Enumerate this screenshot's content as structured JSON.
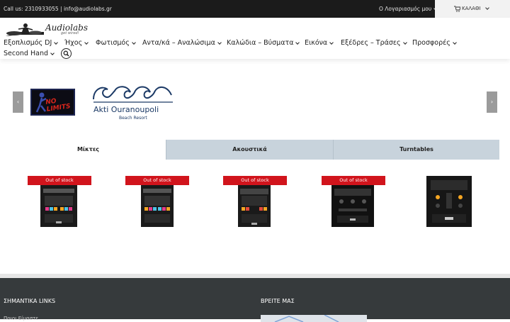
{
  "topbar": {
    "contact": "Call us: 2310933055  |  info@audiolabs.gr",
    "account": "Ο Λογαριασμός μου",
    "cart": "ΚΑΛΑΘΙ"
  },
  "logo": {
    "word": "Audiolabs",
    "tag": "get wired!"
  },
  "nav": {
    "items": [
      "Εξοπλισμός DJ",
      "Ήχος",
      "Φωτισμός",
      "Αντα/κά – Αναλώσιμα",
      "Καλώδια – Βύσματα",
      "Εικόνα",
      "Εξέδρες – Τράσες",
      "Προσφορές",
      "Second Hand"
    ]
  },
  "carousel": {
    "prev": "‹",
    "next": "›",
    "brand1": "NO LIMITS",
    "brand2_name": "Akti Ouranoupoli",
    "brand2_sub": "Beach Resort"
  },
  "tabs": [
    "Μίκτες",
    "Ακουστικά",
    "Turntables"
  ],
  "products": [
    {
      "badge": "Out of stock"
    },
    {
      "badge": "Out of stock"
    },
    {
      "badge": "Out of stock"
    },
    {
      "badge": "Out of stock"
    },
    {
      "badge": ""
    }
  ],
  "footer": {
    "links_heading": "ΣΗΜΑΝΤΙΚΑ LINKS",
    "find_heading": "ΒΡΕΙΤΕ ΜΑΣ",
    "first_link": "Ποιοι Είμαστε"
  },
  "colors": {
    "topbar": "#1b1b1b",
    "badge": "#d1141c",
    "tab_inactive": "#c8d3dc",
    "footer": "#363a3c"
  }
}
